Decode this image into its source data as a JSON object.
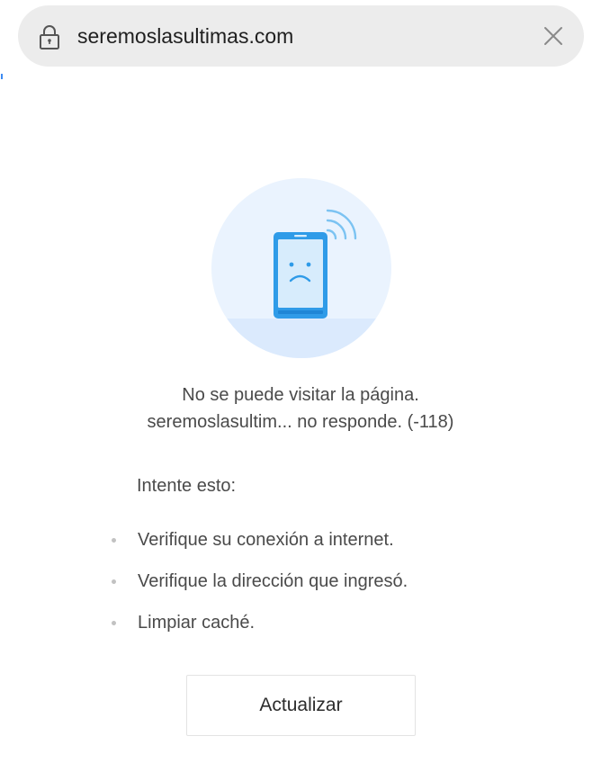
{
  "address_bar": {
    "url": "seremoslasultimas.com",
    "lock_icon": "lock-icon",
    "close_icon": "close-icon"
  },
  "error": {
    "illustration_icon": "phone-sad-face-no-signal-icon",
    "title": "No se puede visitar la página.",
    "detail": "seremoslasultim... no responde. (-118)",
    "try_label": "Intente esto:",
    "tips": [
      "Verifique su conexión a internet.",
      "Verifique la dirección que ingresó.",
      "Limpiar caché."
    ],
    "refresh_label": "Actualizar"
  },
  "colors": {
    "accent_blue": "#2f9be8",
    "circle_bg": "#eaf3fe",
    "urlbar_bg": "#ececec"
  }
}
